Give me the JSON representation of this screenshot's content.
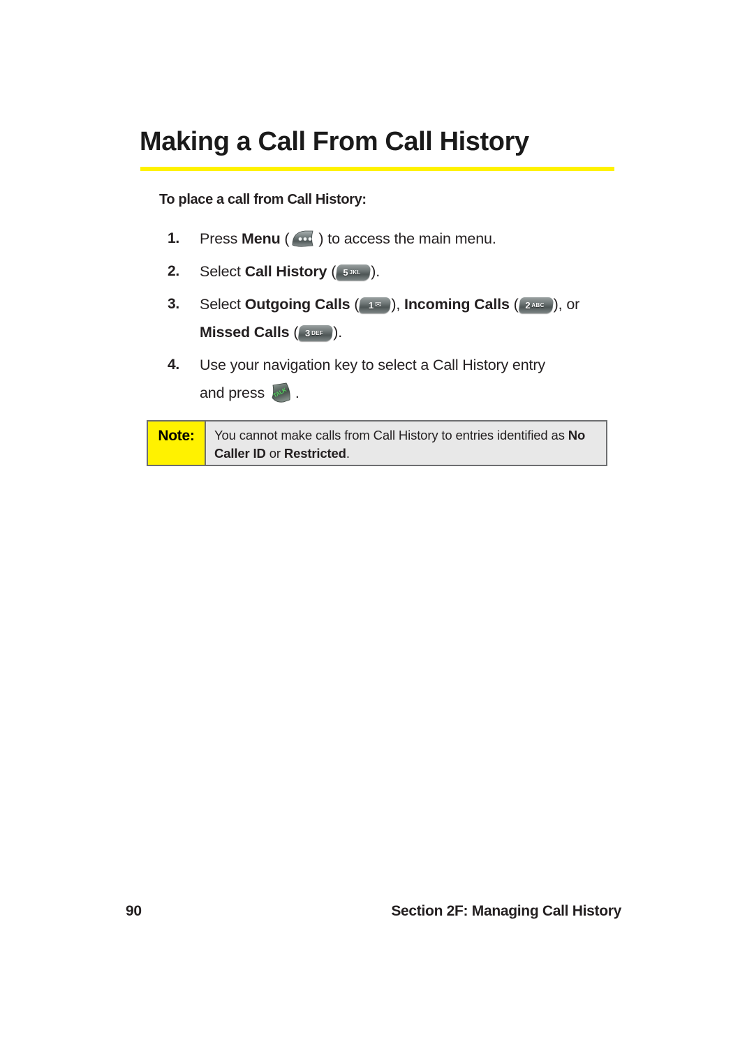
{
  "page": {
    "title": "Making a Call From Call History",
    "subhead": "To place a call from Call History:",
    "accent_color": "#FFF200",
    "text_color": "#231F20"
  },
  "steps": [
    {
      "number": "1.",
      "line1_pre": "Press ",
      "line1_bold": "Menu",
      "line1_post": " (",
      "key": "menu-soft-key",
      "line1_tail": ") to access the main menu."
    },
    {
      "number": "2.",
      "line1_pre": "Select ",
      "line1_bold": "Call History",
      "line1_post": " (",
      "key_digit": "5",
      "key_letters": "JKL",
      "line1_tail": ")."
    },
    {
      "number": "3.",
      "pre": "Select ",
      "bold1": "Outgoing Calls",
      "mid1": " (",
      "key1_digit": "1",
      "key1_glyph": "envelope-icon",
      "mid2": "), ",
      "bold2": "Incoming Calls",
      "mid3": " (",
      "key2_digit": "2",
      "key2_letters": "ABC",
      "mid4": "), or",
      "bold3": "Missed Calls",
      "mid5": " (",
      "key3_digit": "3",
      "key3_letters": "DEF",
      "tail": ")."
    },
    {
      "number": "4.",
      "line1": "Use your navigation key to select a Call History entry",
      "line2_pre": "and press ",
      "key": "talk-key",
      "key_label": "TALK",
      "line2_tail": "."
    }
  ],
  "note": {
    "label": "Note:",
    "body_pre": "You cannot make calls from Call History to entries identified as ",
    "bold1": "No Caller ID",
    "mid": " or ",
    "bold2": "Restricted",
    "tail": ".",
    "label_bg": "#FFF200",
    "body_bg": "#E8E8E8"
  },
  "footer": {
    "page_number": "90",
    "section": "Section 2F: Managing Call History"
  }
}
